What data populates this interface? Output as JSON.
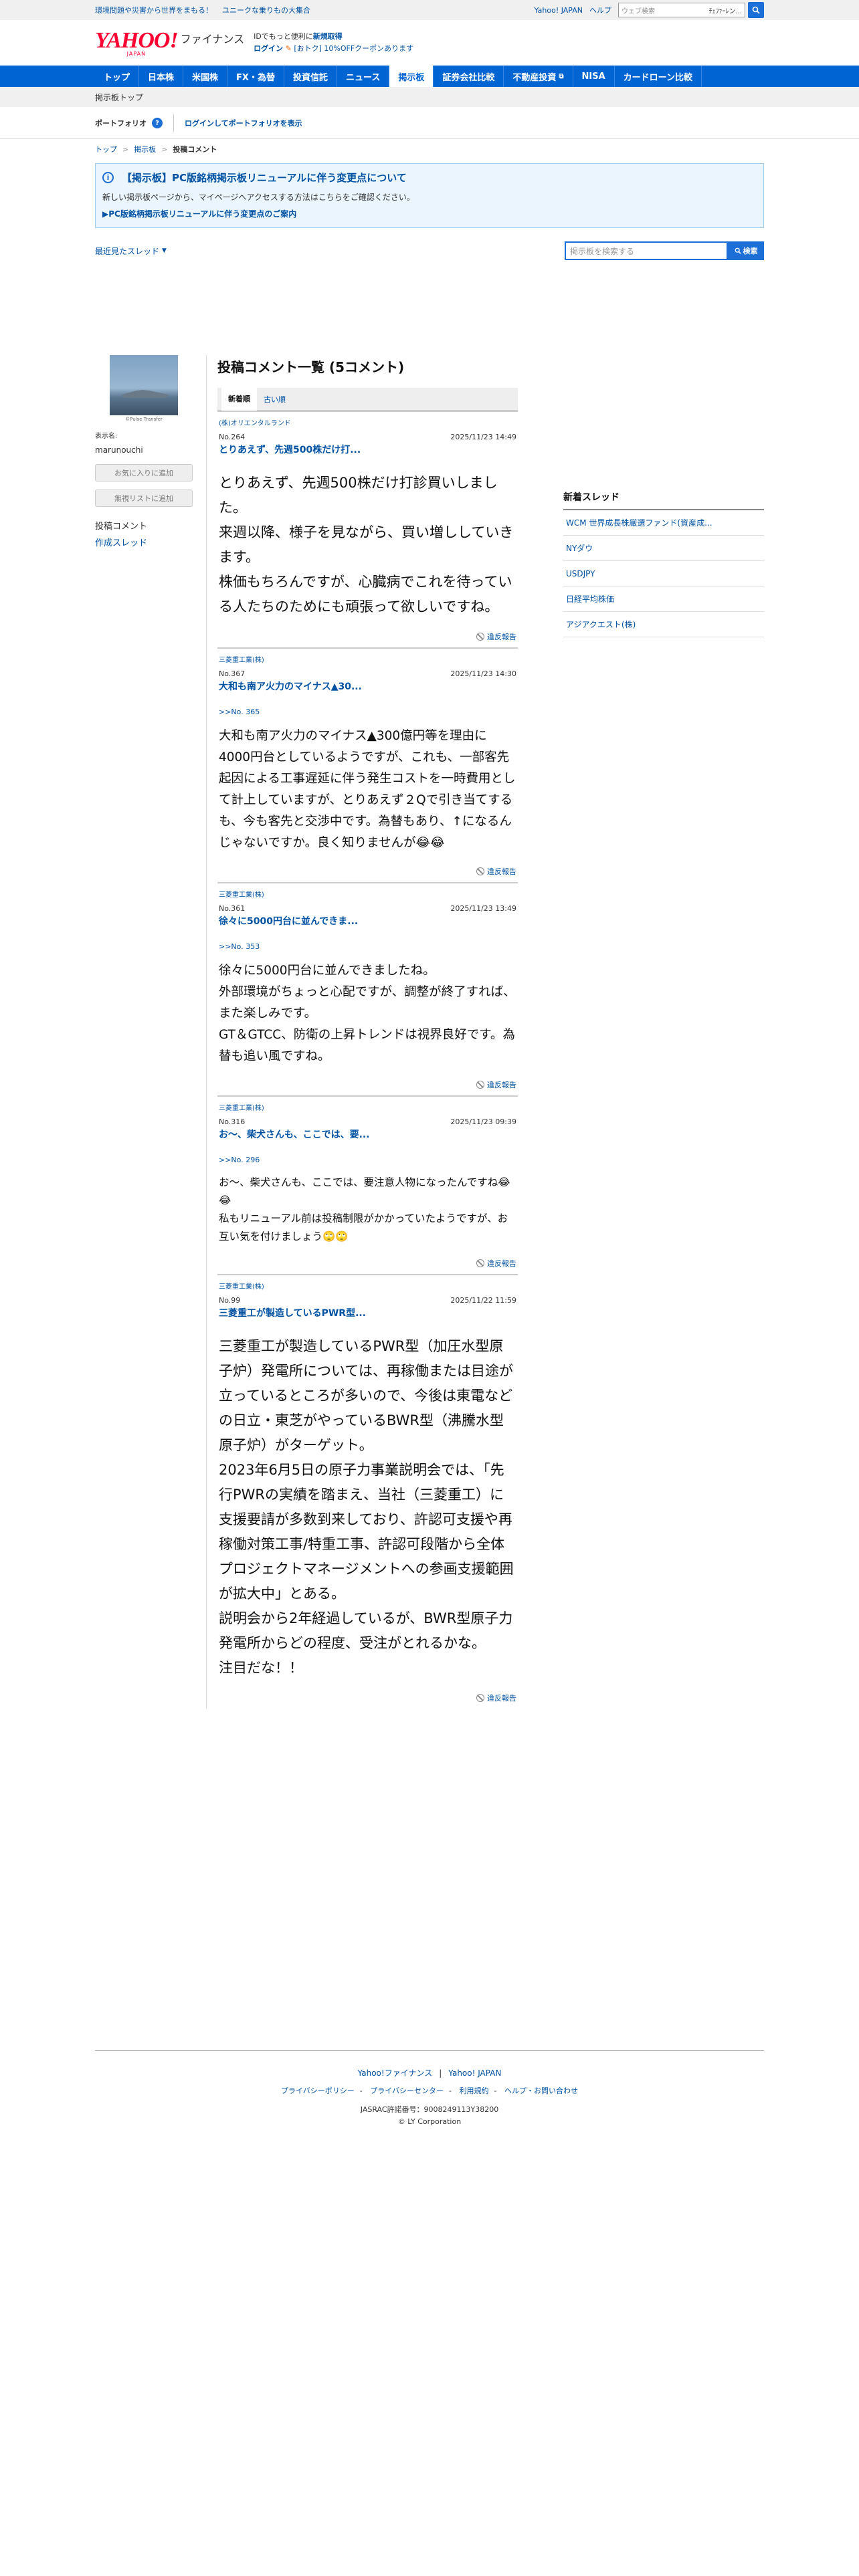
{
  "topbar": {
    "promo1": "環境問題や災害から世界をまもる！",
    "promo2": "ユニークな乗りもの大集合",
    "yahoo_japan": "Yahoo! JAPAN",
    "help": "ヘルプ",
    "search_placeholder": "ウェブ検索",
    "search_tag": "ﾁｪﾌｧｰﾚン..."
  },
  "header": {
    "logo_main": "YAHOO!",
    "logo_sub": "JAPAN",
    "logo_finance": "ファイナンス",
    "msg_pre": "IDでもっと便利に",
    "msg_signup": "新規取得",
    "login": "ログイン",
    "coupon": "[おトク] 10%OFFクーポンあります"
  },
  "gnav": [
    "トップ",
    "日本株",
    "米国株",
    "FX・為替",
    "投資信託",
    "ニュース",
    "掲示板",
    "証券会社比較",
    "不動産投資",
    "NISA",
    "カードローン比較"
  ],
  "gnav_active": "掲示板",
  "subnav": "掲示板トップ",
  "portfolio": {
    "label": "ポートフォリオ",
    "login_link": "ログインしてポートフォリオを表示"
  },
  "breadcrumb": [
    "トップ",
    "掲示板",
    "投稿コメント"
  ],
  "notice": {
    "title": "【掲示板】PC版銘柄掲示板リニューアルに伴う変更点について",
    "desc": "新しい掲示板ページから、マイページへアクセスする方法はこちらをご確認ください。",
    "link": "▶PC版銘柄掲示板リニューアルに伴う変更点のご案内"
  },
  "filter": {
    "recent": "最近見たスレッド",
    "search_placeholder": "掲示板を検索する",
    "search_btn": "検索"
  },
  "profile": {
    "caption": "©Pulse Transfer",
    "name_label": "表示名:",
    "name": "marunouchi",
    "fav_btn": "お気に入りに追加",
    "ignore_btn": "無視リストに追加",
    "menu_posts": "投稿コメント",
    "menu_threads": "作成スレッド"
  },
  "main": {
    "title": "投稿コメント一覧 (5コメント)",
    "tab_new": "新着順",
    "tab_old": "古い順",
    "report": "違反報告"
  },
  "posts": [
    {
      "category": "(株)オリエンタルランド",
      "no": "No.264",
      "date": "2025/11/23 14:49",
      "title": "とりあえず、先週500株だけ打...",
      "reply": "",
      "lines": [
        "とりあえず、先週500株だけ打診買いしました。",
        "来週以降、様子を見ながら、買い増ししていきます。",
        "株価もちろんですが、心臓病でこれを待っている人たちのためにも頑張って欲しいですね。"
      ]
    },
    {
      "category": "三菱重工業(株)",
      "no": "No.367",
      "date": "2025/11/23 14:30",
      "title": "大和も南ア火力のマイナス▲30...",
      "reply": ">>No. 365",
      "lines": [
        "大和も南ア火力のマイナス▲300億円等を理由に4000円台としているようですが、これも、一部客先起因による工事遅延に伴う発生コストを一時費用として計上していますが、とりあえず２Qで引き当てするも、今も客先と交渉中です。為替もあり、↑になるんじゃないですか。良く知りませんが😂😂"
      ]
    },
    {
      "category": "三菱重工業(株)",
      "no": "No.361",
      "date": "2025/11/23 13:49",
      "title": "徐々に5000円台に並んできま...",
      "reply": ">>No. 353",
      "lines": [
        "徐々に5000円台に並んできましたね。",
        "外部環境がちょっと心配ですが、調整が終了すれば、また楽しみです。",
        "GT＆GTCC、防衛の上昇トレンドは視界良好です。為替も追い風ですね。"
      ]
    },
    {
      "category": "三菱重工業(株)",
      "no": "No.316",
      "date": "2025/11/23 09:39",
      "title": "お〜、柴犬さんも、ここでは、要...",
      "reply": ">>No. 296",
      "lines": [
        "お〜、柴犬さんも、ここでは、要注意人物になったんですね😂😂",
        "私もリニューアル前は投稿制限がかかっていたようですが、お互い気を付けましょう🙄🙄"
      ]
    },
    {
      "category": "三菱重工業(株)",
      "no": "No.99",
      "date": "2025/11/22 11:59",
      "title": "三菱重工が製造しているPWR型...",
      "reply": "",
      "lines": [
        "三菱重工が製造しているPWR型（加圧水型原子炉）発電所については、再稼働または目途が立っているところが多いので、今後は東電などの日立・東芝がやっているBWR型（沸騰水型原子炉）がターゲット。",
        "2023年6月5日の原子力事業説明会では、「先行PWRの実績を踏まえ、当社（三菱重工）に支援要請が多数到来しており、許認可支援や再稼働対策工事/特重工事、許認可段階から全体プロジェクトマネージメントへの参画支援範囲が拡大中」とある。",
        "説明会から2年経過しているが、BWR型原子力発電所からどの程度、受注がとれるかな。",
        "注目だな！！"
      ]
    }
  ],
  "sidebar": {
    "heading": "新着スレッド",
    "threads": [
      "WCM 世界成長株厳選ファンド(資産成...",
      "NYダウ",
      "USDJPY",
      "日経平均株価",
      "アジアクエスト(株)"
    ]
  },
  "footer": {
    "link1": "Yahoo!ファイナンス",
    "link2": "Yahoo! JAPAN",
    "privacy": "プライバシーポリシー",
    "privacy_center": "プライバシーセンター",
    "terms": "利用規約",
    "contact": "ヘルプ・お問い合わせ",
    "jasrac": "JASRAC許諾番号：9008249113Y38200",
    "copyright": "© LY Corporation"
  },
  "colors": {
    "brand_blue": "#0064d2",
    "link_blue": "#0052a3",
    "yahoo_red": "#ff0033"
  }
}
